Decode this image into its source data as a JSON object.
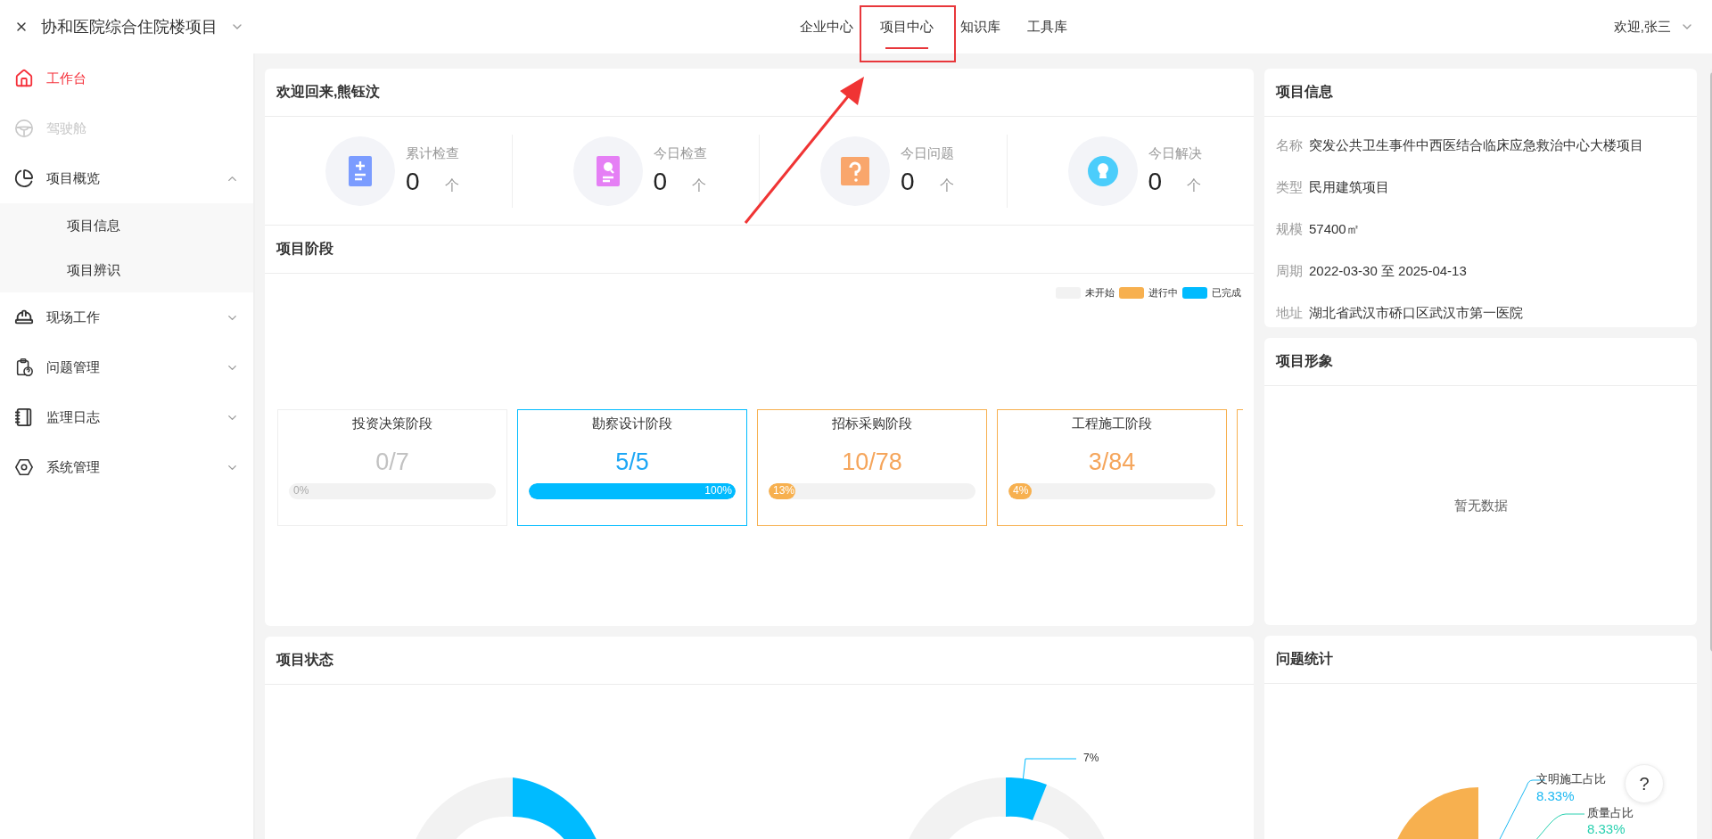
{
  "project_title": "协和医院综合住院楼项目",
  "nav_tabs": [
    {
      "label": "企业中心",
      "selected": false
    },
    {
      "label": "项目中心",
      "selected": true
    },
    {
      "label": "知识库",
      "selected": false
    },
    {
      "label": "工具库",
      "selected": false
    }
  ],
  "user_menu": {
    "label": "欢迎,张三"
  },
  "sidebar": {
    "items": [
      {
        "label": "工作台",
        "selected": true,
        "disabled": false
      },
      {
        "label": "驾驶舱",
        "selected": false,
        "disabled": true
      },
      {
        "label": "项目概览",
        "selected": false,
        "disabled": false,
        "expanded": true,
        "children": [
          {
            "label": "项目信息",
            "selected": false
          },
          {
            "label": "项目辨识",
            "selected": false
          }
        ]
      },
      {
        "label": "现场工作",
        "selected": false,
        "disabled": false,
        "expanded": false
      },
      {
        "label": "问题管理",
        "selected": false,
        "disabled": false,
        "expanded": false
      },
      {
        "label": "监理日志",
        "selected": false,
        "disabled": false,
        "expanded": false
      },
      {
        "label": "系统管理",
        "selected": false,
        "disabled": false,
        "expanded": false
      }
    ]
  },
  "welcome": {
    "title": "欢迎回来,熊钰汶",
    "stats": [
      {
        "label": "累计检查",
        "value": "0",
        "unit": "个"
      },
      {
        "label": "今日检查",
        "value": "0",
        "unit": "个"
      },
      {
        "label": "今日问题",
        "value": "0",
        "unit": "个"
      },
      {
        "label": "今日解决",
        "value": "0",
        "unit": "个"
      }
    ]
  },
  "stages": {
    "title": "项目阶段",
    "legend": [
      {
        "label": "未开始",
        "color": "#f2f2f2"
      },
      {
        "label": "进行中",
        "color": "#f7b04f"
      },
      {
        "label": "已完成",
        "color": "#00bbff"
      }
    ],
    "items": [
      {
        "name": "投资决策阶段",
        "count": "0/7",
        "percent": "0%",
        "level": 0,
        "kind": "not_started"
      },
      {
        "name": "勘察设计阶段",
        "count": "5/5",
        "percent": "100%",
        "level": 1,
        "kind": "done"
      },
      {
        "name": "招标采购阶段",
        "count": "10/78",
        "percent": "13%",
        "level": 0.13,
        "kind": "in_progress"
      },
      {
        "name": "工程施工阶段",
        "count": "3/84",
        "percent": "4%",
        "level": 0.04,
        "kind": "in_progress"
      },
      {
        "kind": "in_progress"
      }
    ]
  },
  "project_status": {
    "title": "项目状态",
    "donut_labels": [
      "7%"
    ]
  },
  "project_info": {
    "title": "项目信息",
    "rows": [
      {
        "label": "名称",
        "value": "突发公共卫生事件中西医结合临床应急救治中心大楼项目"
      },
      {
        "label": "类型",
        "value": "民用建筑项目"
      },
      {
        "label": "规模",
        "value": "57400㎡"
      },
      {
        "label": "周期",
        "value": "2022-03-30 至 2025-04-13"
      },
      {
        "label": "地址",
        "value": "湖北省武汉市硚口区武汉市第一医院"
      }
    ]
  },
  "project_image": {
    "title": "项目形象",
    "empty_text": "暂无数据"
  },
  "issue_stats": {
    "title": "问题统计",
    "pie_labels": [
      {
        "name": "文明施工占比",
        "value": "8.33%",
        "color": "#1cb8f2"
      },
      {
        "name": "质量占比",
        "value": "8.33%",
        "color": "#2ad1b0"
      }
    ]
  },
  "help": {
    "label": "?"
  }
}
